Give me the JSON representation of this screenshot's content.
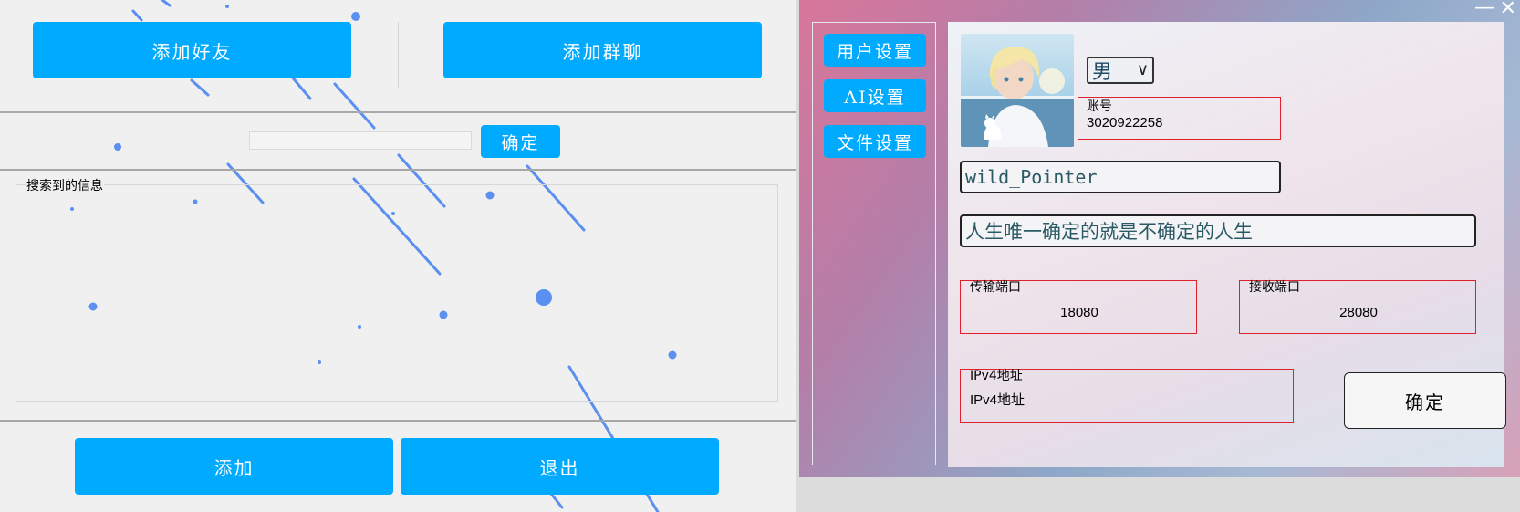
{
  "left_window": {
    "add_friend_label": "添加好友",
    "add_group_label": "添加群聊",
    "search_value": "",
    "confirm_label": "确定",
    "results_groupbox_title": "搜索到的信息",
    "add_label": "添加",
    "exit_label": "退出"
  },
  "right_window": {
    "window_controls": {
      "minimize": "—",
      "close": "✕"
    },
    "nav": [
      "用户设置",
      "AI设置",
      "文件设置"
    ],
    "gender": "男",
    "account": {
      "caption": "账号",
      "value": "3020922258"
    },
    "username": "wild_Pointer",
    "signature": "人生唯一确定的就是不确定的人生",
    "send_port": {
      "caption": "传输端口",
      "value": "18080"
    },
    "recv_port": {
      "caption": "接收端口",
      "value": "28080"
    },
    "ipv4": {
      "caption": "IPv4地址",
      "value": "IPv4地址"
    },
    "confirm_label": "确定"
  },
  "colors": {
    "button_blue": "#00aaff",
    "frame_red": "#e0202a",
    "rain_blue": "#5b8ff0"
  }
}
